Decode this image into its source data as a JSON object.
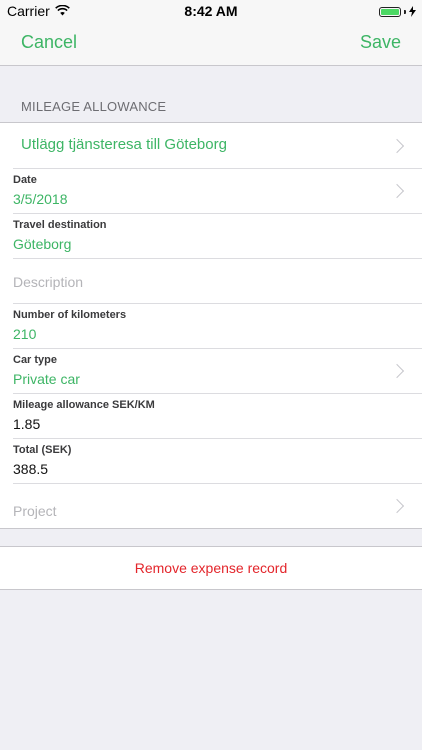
{
  "status_bar": {
    "carrier": "Carrier",
    "time": "8:42 AM",
    "wifi_icon": "wifi-icon",
    "battery_icon": "battery-icon",
    "charging_icon": "bolt-icon"
  },
  "nav": {
    "cancel_label": "Cancel",
    "save_label": "Save",
    "accent_color": "#3db565"
  },
  "section": {
    "header": "MILEAGE ALLOWANCE"
  },
  "form": {
    "title": "Utlägg tjänsteresa till Göteborg",
    "date": {
      "label": "Date",
      "value": "3/5/2018"
    },
    "destination": {
      "label": "Travel destination",
      "value": "Göteborg"
    },
    "description": {
      "placeholder": "Description"
    },
    "kilometers": {
      "label": "Number of kilometers",
      "value": "210"
    },
    "car_type": {
      "label": "Car type",
      "value": "Private car"
    },
    "allowance": {
      "label": "Mileage allowance SEK/KM",
      "value": "1.85"
    },
    "total": {
      "label": "Total (SEK)",
      "value": "388.5"
    },
    "project": {
      "placeholder": "Project"
    }
  },
  "remove": {
    "label": "Remove expense record",
    "color": "#e3252b"
  }
}
